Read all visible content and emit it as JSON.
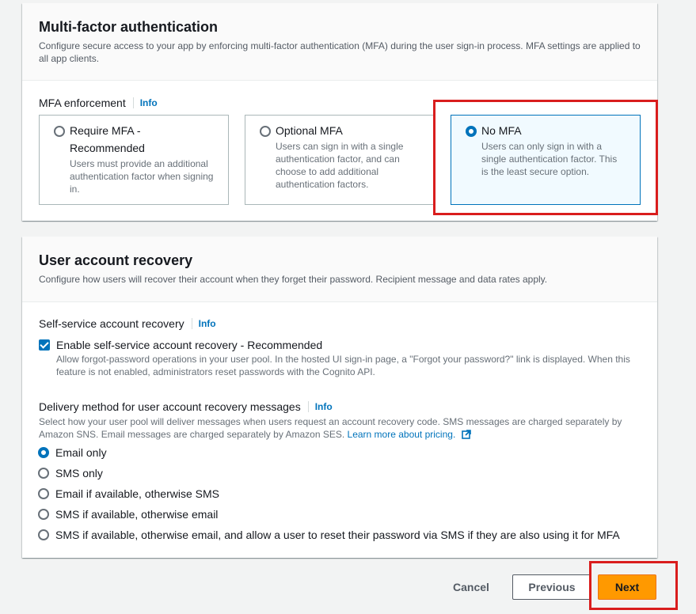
{
  "mfa": {
    "title": "Multi-factor authentication",
    "description": "Configure secure access to your app by enforcing multi-factor authentication (MFA) during the user sign-in process. MFA settings are applied to all app clients.",
    "enforcement_label": "MFA enforcement",
    "info": "Info",
    "options": [
      {
        "title": "Require MFA - Recommended",
        "description": "Users must provide an additional authentication factor when signing in.",
        "selected": false
      },
      {
        "title": "Optional MFA",
        "description": "Users can sign in with a single authentication factor, and can choose to add additional authentication factors.",
        "selected": false
      },
      {
        "title": "No MFA",
        "description": "Users can only sign in with a single authentication factor. This is the least secure option.",
        "selected": true
      }
    ]
  },
  "recovery": {
    "title": "User account recovery",
    "description": "Configure how users will recover their account when they forget their password. Recipient message and data rates apply.",
    "self_service_label": "Self-service account recovery",
    "info": "Info",
    "checkbox_label": "Enable self-service account recovery - Recommended",
    "checkbox_checked": true,
    "checkbox_desc": "Allow forgot-password operations in your user pool. In the hosted UI sign-in page, a \"Forgot your password?\" link is displayed. When this feature is not enabled, administrators reset passwords with the Cognito API.",
    "delivery_label": "Delivery method for user account recovery messages",
    "delivery_desc": "Select how your user pool will deliver messages when users request an account recovery code. SMS messages are charged separately by Amazon SNS. Email messages are charged separately by Amazon SES.",
    "learn_more": "Learn more about pricing.",
    "delivery_options": [
      {
        "label": "Email only",
        "selected": true
      },
      {
        "label": "SMS only",
        "selected": false
      },
      {
        "label": "Email if available, otherwise SMS",
        "selected": false
      },
      {
        "label": "SMS if available, otherwise email",
        "selected": false
      },
      {
        "label": "SMS if available, otherwise email, and allow a user to reset their password via SMS if they are also using it for MFA",
        "selected": false
      }
    ]
  },
  "footer": {
    "cancel": "Cancel",
    "previous": "Previous",
    "next": "Next"
  },
  "colors": {
    "accent": "#0073bb",
    "primary_button": "#ff9900",
    "highlight_box": "#d91d1d"
  }
}
